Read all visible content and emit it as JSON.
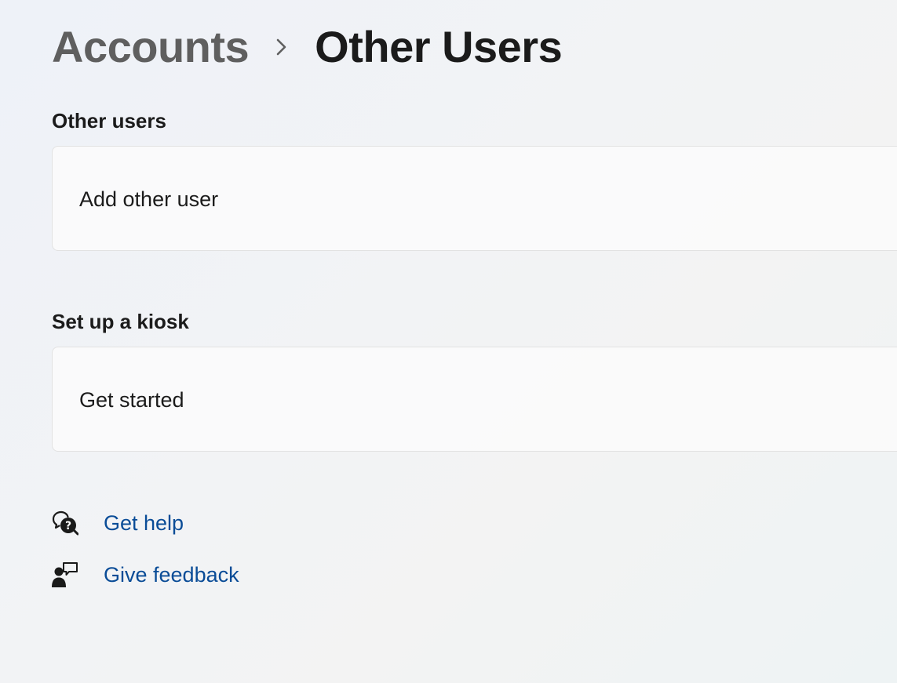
{
  "breadcrumb": {
    "parent": "Accounts",
    "current": "Other Users"
  },
  "sections": {
    "other_users": {
      "title": "Other users",
      "card_label": "Add other user"
    },
    "kiosk": {
      "title": "Set up a kiosk",
      "card_label": "Get started"
    }
  },
  "links": {
    "help": {
      "label": "Get help",
      "icon": "help-icon"
    },
    "feedback": {
      "label": "Give feedback",
      "icon": "feedback-icon"
    }
  },
  "colors": {
    "link": "#0a4c97",
    "breadcrumb_parent": "#5f5f5f",
    "text": "#1b1b1b"
  }
}
